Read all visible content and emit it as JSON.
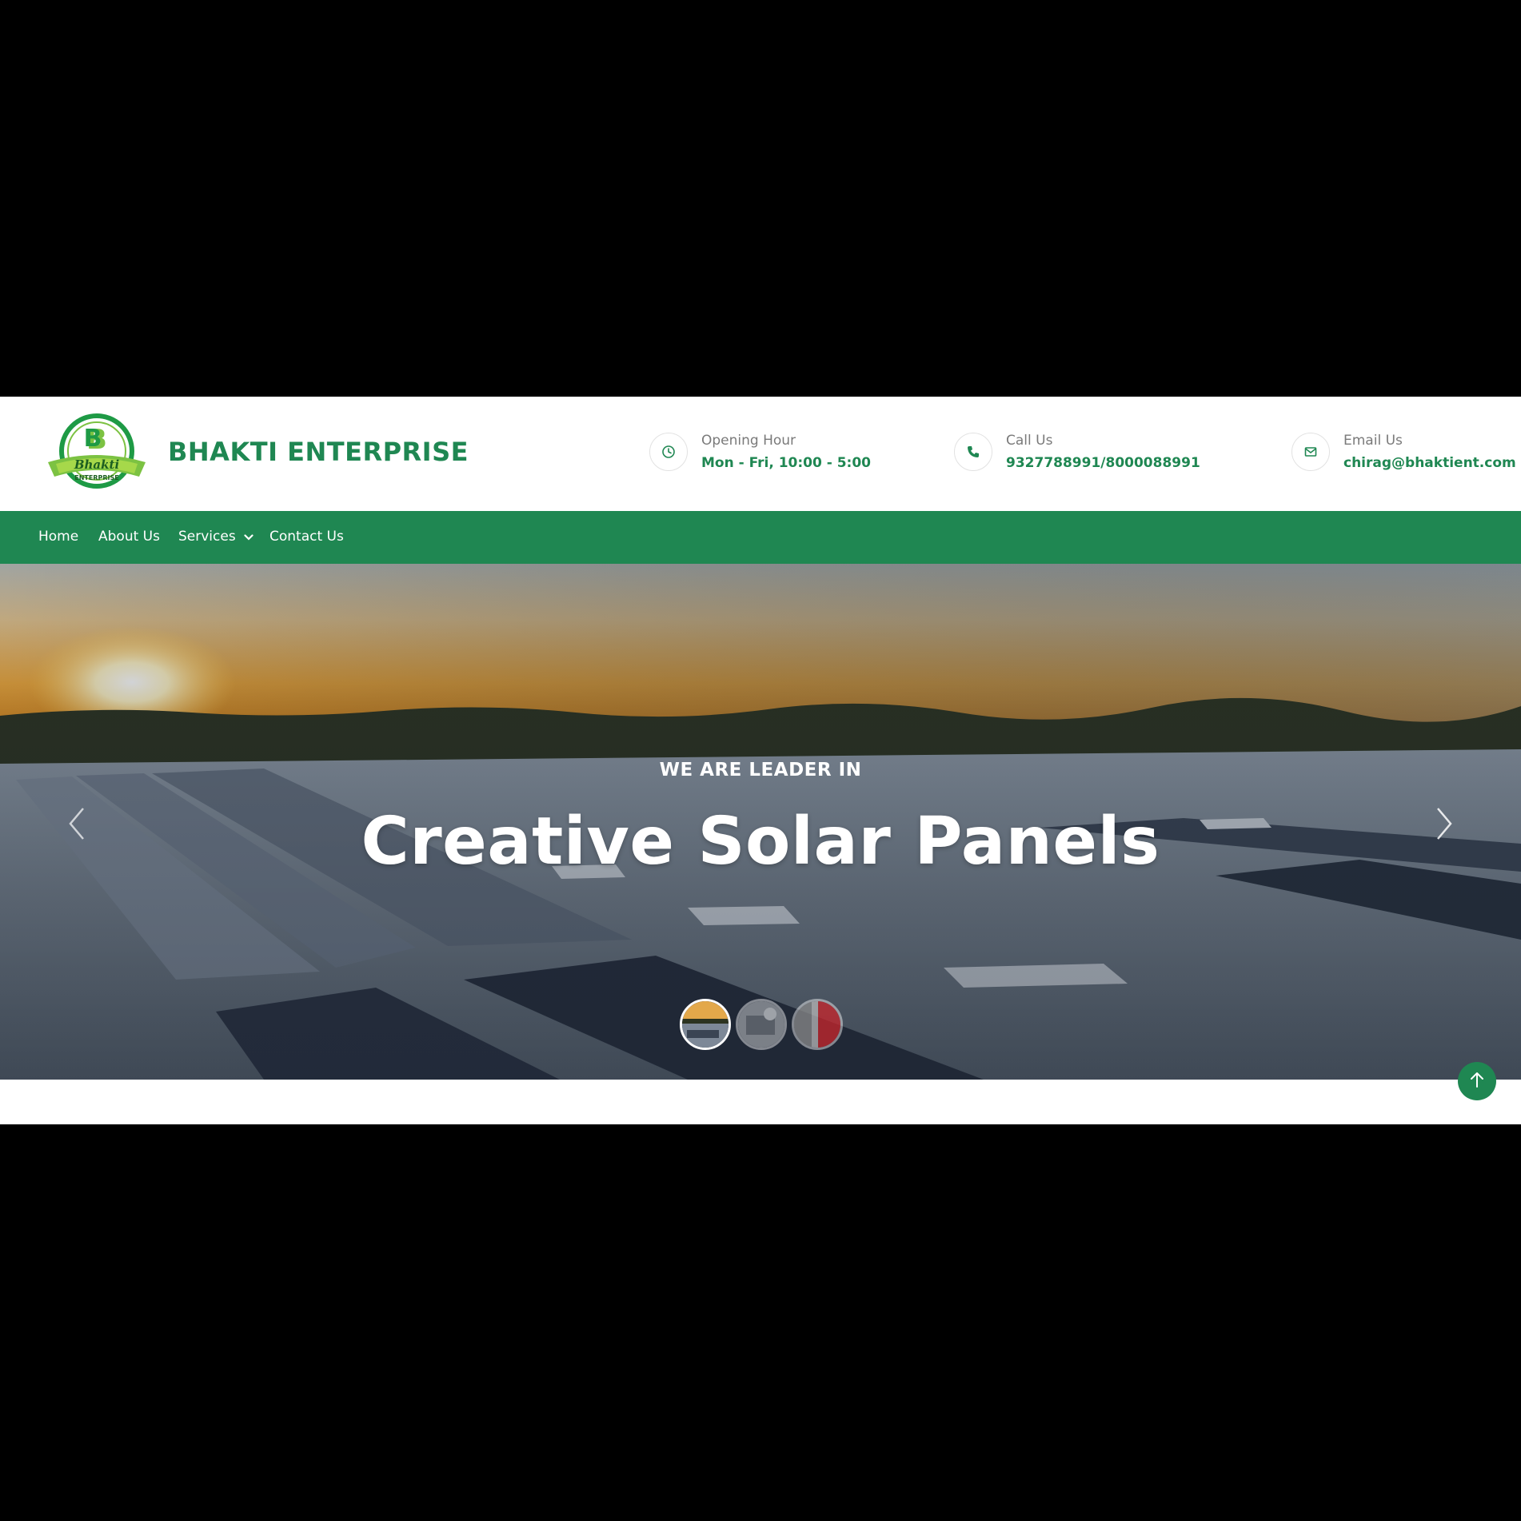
{
  "brand": {
    "name": "BHAKTI ENTERPRISE",
    "logo_script": "Bhakti",
    "logo_small": "ENTERPRISE",
    "color": "#1f8752"
  },
  "header_info": [
    {
      "icon": "clock-icon",
      "label": "Opening Hour",
      "value": "Mon - Fri, 10:00 - 5:00"
    },
    {
      "icon": "phone-icon",
      "label": "Call Us",
      "value": "9327788991/8000088991"
    },
    {
      "icon": "envelope-icon",
      "label": "Email Us",
      "value": "chirag@bhaktient.com"
    }
  ],
  "nav": {
    "items": [
      {
        "label": "Home"
      },
      {
        "label": "About Us"
      },
      {
        "label": "Services",
        "has_dropdown": true
      },
      {
        "label": "Contact Us"
      }
    ]
  },
  "hero": {
    "kicker": "WE ARE LEADER IN",
    "headline": "Creative Solar Panels",
    "slides": 3,
    "active_slide": 1
  },
  "colors": {
    "accent": "#1f8752",
    "nav_text": "#ffffff",
    "muted_text": "#7a7a7a"
  }
}
